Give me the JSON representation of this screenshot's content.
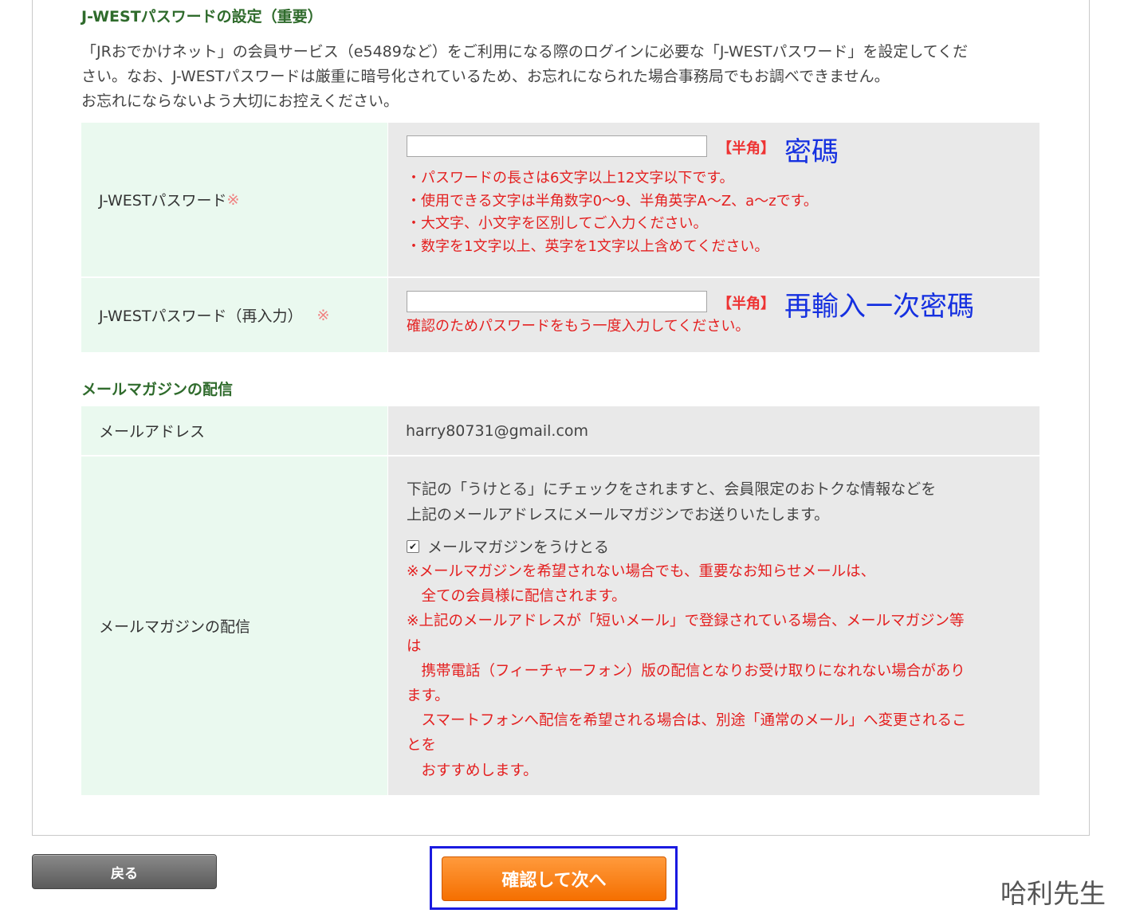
{
  "password_section": {
    "title": "J-WESTパスワードの設定（重要）",
    "intro_line1": "「JRおでかけネット」の会員サービス（e5489など）をご利用になる際のログインに必要な「J-WESTパスワード」を設定してくだ",
    "intro_line2": "さい。なお、J-WESTパスワードは厳重に暗号化されているため、お忘れになられた場合事務局でもお調べできません。",
    "intro_line3": "お忘れにならないよう大切にお控えください。",
    "password": {
      "label": "J-WESTパスワード",
      "required_mark": "※",
      "value": "",
      "type_note": "【半角】",
      "annotation": "密碼",
      "rules": [
        "・パスワードの長さは6文字以上12文字以下です。",
        "・使用できる文字は半角数字0～9、半角英字A～Z、a～zです。",
        "・大文字、小文字を区別してご入力ください。",
        "・数字を1文字以上、英字を1文字以上含めてください。"
      ]
    },
    "password_confirm": {
      "label": "J-WESTパスワード（再入力）",
      "required_mark": "※",
      "value": "",
      "type_note": "【半角】",
      "annotation": "再輸入一次密碼",
      "hint": "確認のためパスワードをもう一度入力してください。"
    }
  },
  "mail_section": {
    "title": "メールマガジンの配信",
    "email": {
      "label": "メールアドレス",
      "value": "harry80731@gmail.com"
    },
    "magazine": {
      "label": "メールマガジンの配信",
      "desc_line1": "下記の「うけとる」にチェックをされますと、会員限定のおトクな情報などを",
      "desc_line2": "上記のメールアドレスにメールマガジンでお送りいたします。",
      "checkbox_label": "メールマガジンをうけとる",
      "checked": true,
      "notes": [
        "※メールマガジンを希望されない場合でも、重要なお知らせメールは、",
        "　全ての会員様に配信されます。",
        "※上記のメールアドレスが「短いメール」で登録されている場合、メールマガジン等",
        "は",
        "　携帯電話（フィーチャーフォン）版の配信となりお受け取りになれない場合があり",
        "ます。",
        "　スマートフォンへ配信を希望される場合は、別途「通常のメール」へ変更されるこ",
        "とを",
        "　おすすめします。"
      ]
    }
  },
  "buttons": {
    "back_label": "戻る",
    "next_label": "確認して次へ"
  },
  "watermark": "哈利先生",
  "colors": {
    "section_title": "#2f6b2c",
    "label_bg": "#eaf9ef",
    "value_bg": "#e9e9e9",
    "note_red": "#e42020",
    "next_button": "#f57c00",
    "annotation_blue": "#1530e0"
  }
}
